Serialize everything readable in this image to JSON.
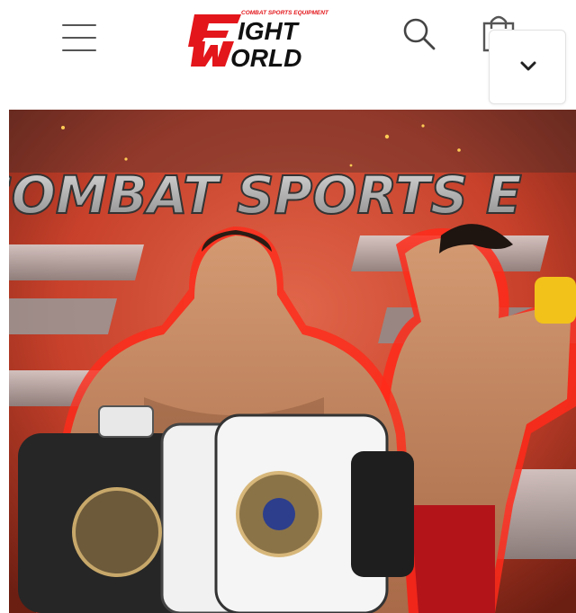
{
  "header": {
    "logo": {
      "tagline": "COMBAT SPORTS EQUIPMENT",
      "line1": "IGHT",
      "line2": "ORLD",
      "brand_color": "#e3161b",
      "text_color": "#111111"
    },
    "icons": {
      "menu": "hamburger-menu-icon",
      "search": "search-icon",
      "cart": "shopping-bag-icon",
      "dropdown": "chevron-down-icon"
    }
  },
  "hero": {
    "banner_text": "COMBAT SPORTS E",
    "colors": {
      "background_red": "#c8412b",
      "dark": "#2a2a2a",
      "glow": "#ff2a1a",
      "skin": "#c98a62",
      "accent_yellow": "#f2c21a"
    }
  }
}
